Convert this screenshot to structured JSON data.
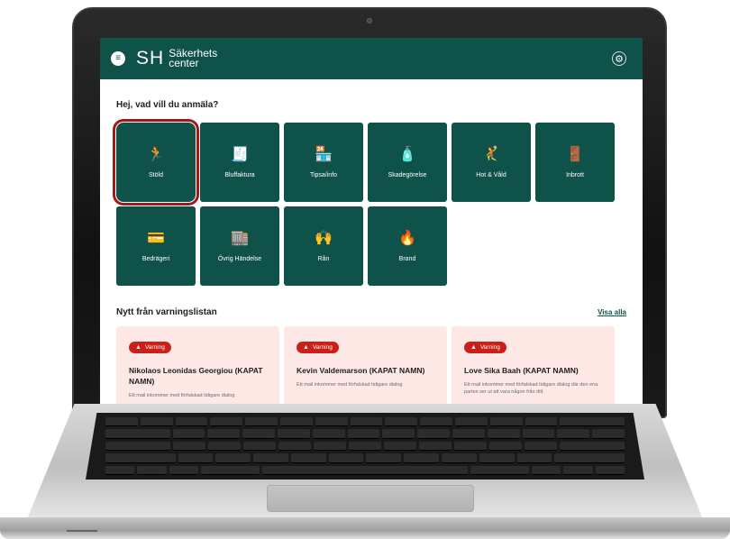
{
  "header": {
    "logo_mark": "SH",
    "logo_line1": "Säkerhets",
    "logo_line2": "center",
    "menu_icon": "hamburger-menu-icon",
    "settings_icon": "gear-icon"
  },
  "greeting": "Hej, vad vill du anmäla?",
  "tiles": [
    {
      "label": "Stöld",
      "icon": "running-thief-icon",
      "glyph": "🏃",
      "selected": true
    },
    {
      "label": "Bluffaktura",
      "icon": "invoice-icon",
      "glyph": "🧾"
    },
    {
      "label": "Tipsa/info",
      "icon": "store-front-icon",
      "glyph": "🏪"
    },
    {
      "label": "Skadegörelse",
      "icon": "spray-can-icon",
      "glyph": "🧴"
    },
    {
      "label": "Hot & Våld",
      "icon": "threat-figure-icon",
      "glyph": "🤾"
    },
    {
      "label": "Inbrott",
      "icon": "break-in-door-icon",
      "glyph": "🚪"
    },
    {
      "label": "Bedrägeri",
      "icon": "card-fraud-icon",
      "glyph": "💳"
    },
    {
      "label": "Övrig Händelse",
      "icon": "shop-event-icon",
      "glyph": "🏬"
    },
    {
      "label": "Rån",
      "icon": "robbery-icon",
      "glyph": "🙌"
    },
    {
      "label": "Brand",
      "icon": "fire-icon",
      "glyph": "🔥"
    }
  ],
  "warnings": {
    "title": "Nytt från varningslistan",
    "see_all": "Visa alla",
    "badge_label": "Varning",
    "cards": [
      {
        "name": "Nikolaos Leonidas Georgiou (KAPAT NAMN)",
        "desc": "Ett mail inkommer med förfalskad tidigare dialog"
      },
      {
        "name": "Kevin Valdemarson (KAPAT NAMN)",
        "desc": "Ett mail inkommer med förfalskad tidigare dialog"
      },
      {
        "name": "Love Sika Baah (KAPAT NAMN)",
        "desc": "Ett mail inkommer med förfalskad tidigare dialog där den ena parten ser ut att vara någon från ditt"
      }
    ]
  },
  "colors": {
    "brand": "#0e5249",
    "warning_badge": "#cc1f1a",
    "card_bg": "#fde8e6",
    "selection": "#a11a1a"
  }
}
